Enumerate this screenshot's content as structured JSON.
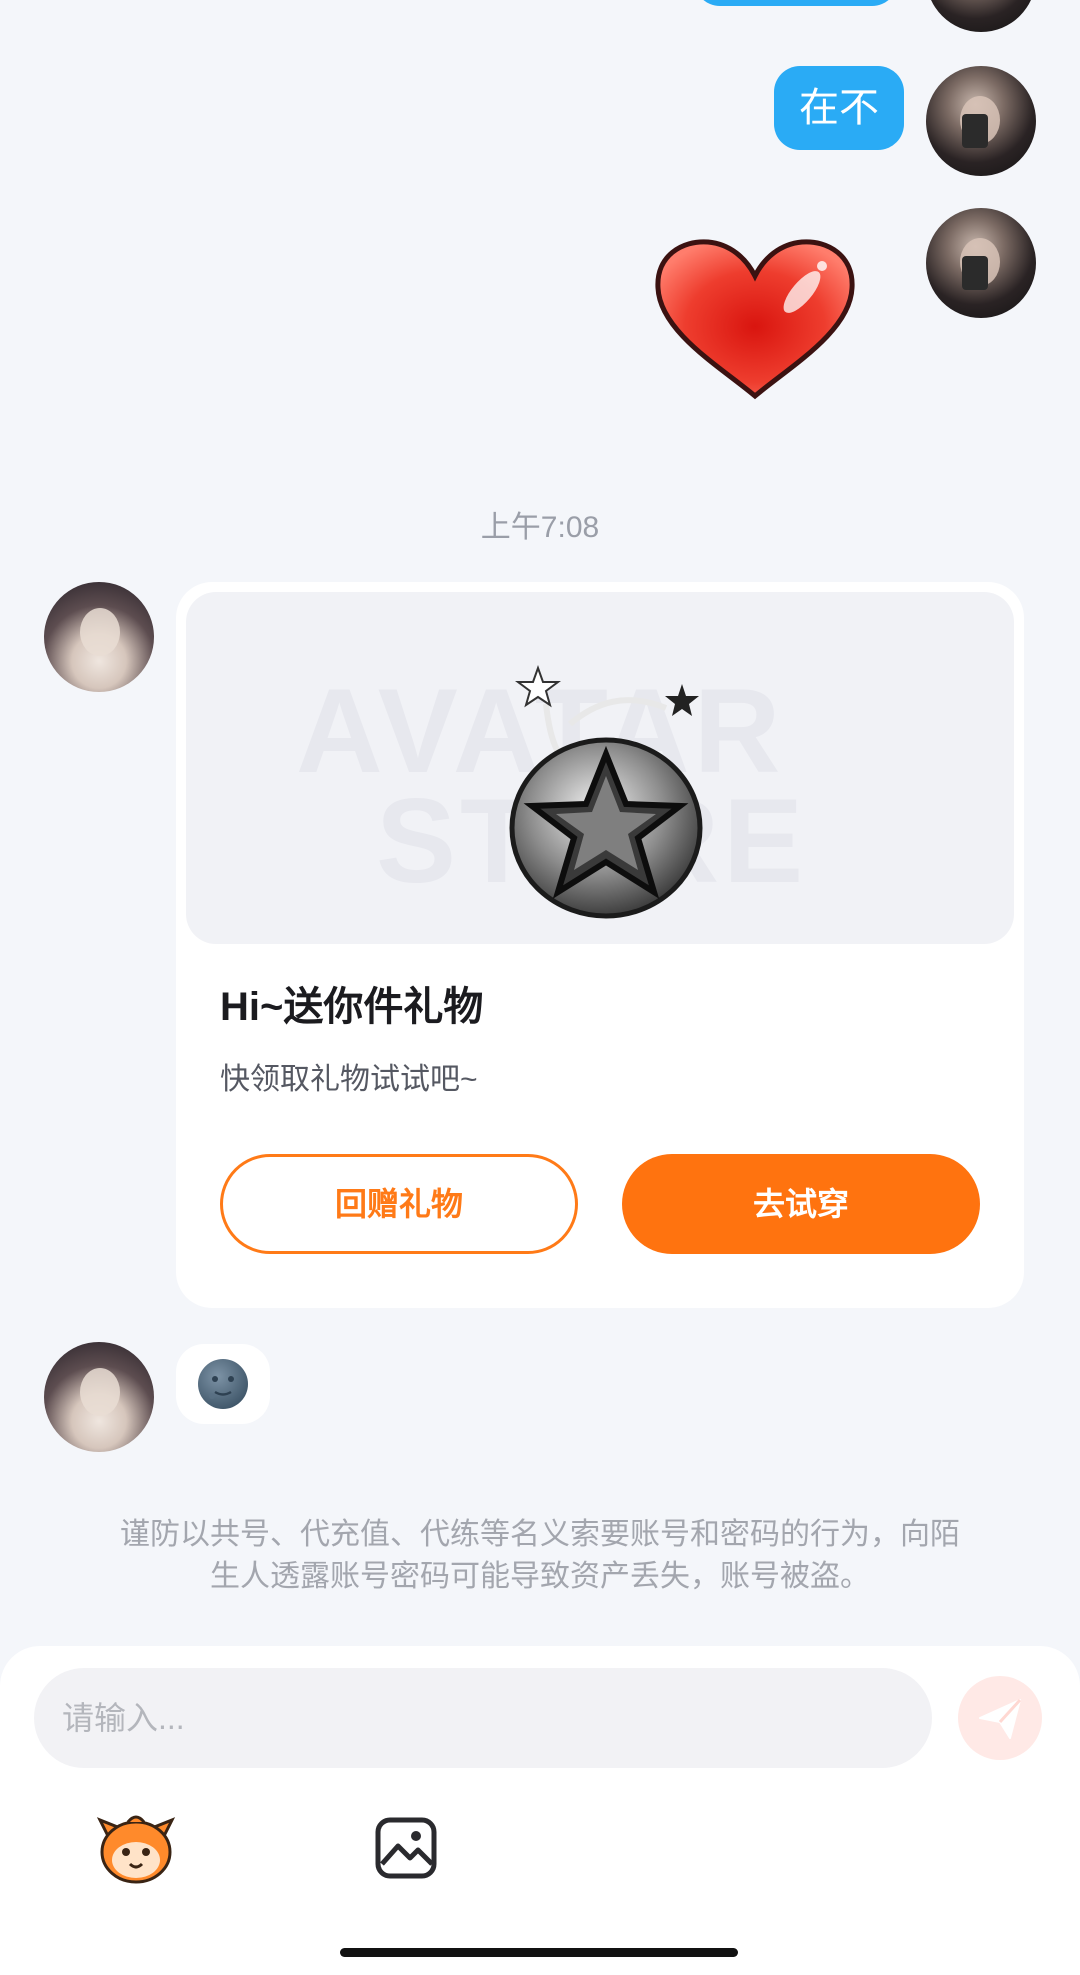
{
  "messages": {
    "text_message": "在不",
    "heart_sticker": "heart-sticker",
    "timestamp": "上午7:08",
    "moon_emoji": "🌚"
  },
  "gift_card": {
    "watermark_top": "AVATAR",
    "watermark_bottom": "STORE",
    "title": "Hi~送你件礼物",
    "subtitle": "快领取礼物试试吧~",
    "return_gift_label": "回赠礼物",
    "try_on_label": "去试穿"
  },
  "notice": {
    "line1": "谨防以共号、代充值、代练等名义索要账号和密码的行为，向陌",
    "line2": "生人透露账号密码可能导致资产丢失，账号被盗。"
  },
  "composer": {
    "placeholder": "请输入...",
    "send_icon": "send-icon",
    "mascot_icon": "mascot-emoji-icon",
    "image_icon": "image-icon"
  },
  "colors": {
    "accent_orange": "#ff730f",
    "bubble_blue": "#2aabf5",
    "background": "#f4f6fa"
  }
}
